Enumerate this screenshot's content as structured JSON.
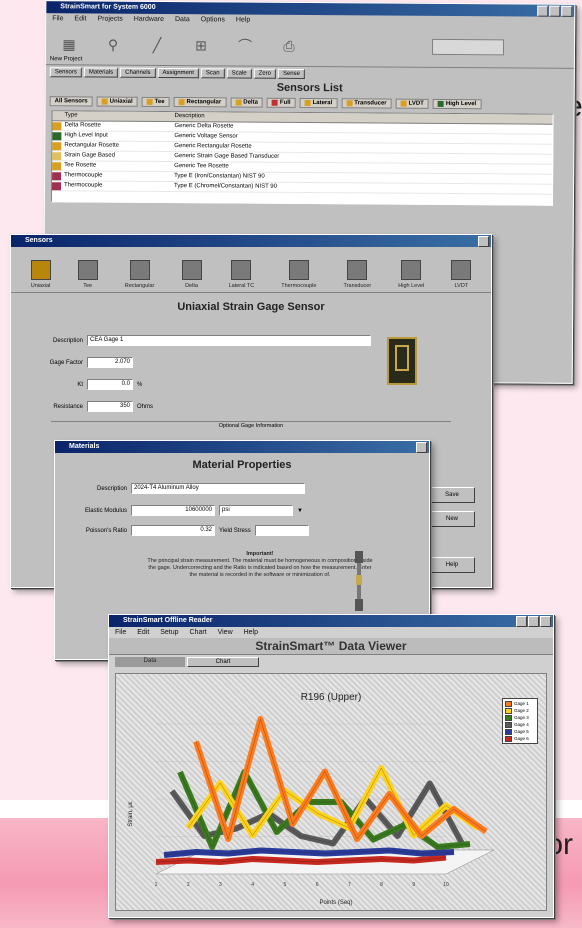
{
  "page": {
    "left_text_1": "e",
    "left_text_2": "for"
  },
  "sensors_window": {
    "title": "StrainSmart for System 6000",
    "menu": [
      "File",
      "Edit",
      "Projects",
      "Hardware",
      "Data",
      "Options",
      "Help"
    ],
    "project_label": "New Project",
    "tabs": [
      "Sensors",
      "Materials",
      "Channels",
      "Assignment",
      "Scan",
      "Scale",
      "Zero",
      "Sense"
    ],
    "heading": "Sensors List",
    "sensor_types": [
      "All Sensors",
      "Uniaxial",
      "Tee",
      "Rectangular",
      "Delta",
      "Full",
      "Lateral",
      "Transducer",
      "LVDT",
      "High Level"
    ],
    "columns": [
      "Type",
      "Description"
    ],
    "rows": [
      {
        "type": "Delta Rosette",
        "desc": "Generic Delta Rosette"
      },
      {
        "type": "High Level Input",
        "desc": "Generic Voltage Sensor"
      },
      {
        "type": "Rectangular Rosette",
        "desc": "Generic Rectangular Rosette"
      },
      {
        "type": "Strain Gage Based",
        "desc": "Generic Strain Gage Based Transducer"
      },
      {
        "type": "Tee Rosette",
        "desc": "Generic Tee Rosette"
      },
      {
        "type": "Thermocouple",
        "desc": "Type E (Iron/Constantan) NIST 90"
      },
      {
        "type": "Thermocouple",
        "desc": "Type E (Chromel/Constantan) NIST 90"
      }
    ]
  },
  "uniaxial_window": {
    "title": "Sensors",
    "toolbar": [
      "Uniaxial",
      "Tee",
      "Rectangular",
      "Delta",
      "Lateral TC",
      "Thermocouple",
      "Transducer",
      "High Level",
      "LVDT"
    ],
    "heading": "Uniaxial Strain Gage Sensor",
    "description_label": "Description",
    "description_value": "CEA Gage 1",
    "gage_factor_label": "Gage Factor",
    "gage_factor_value": "2.070",
    "kt_label": "Kt",
    "kt_value": "0.0",
    "kt_unit": "%",
    "resistance_label": "Resistance",
    "resistance_value": "350",
    "resistance_unit": "Ohms",
    "optional_label": "Optional Gage Information",
    "btn_save": "Save",
    "btn_new": "New",
    "btn_help": "Help"
  },
  "material_window": {
    "title": "Materials",
    "heading": "Material Properties",
    "description_label": "Description",
    "description_value": "2024-T4 Aluminum Alloy",
    "elastic_label": "Elastic Modulus",
    "elastic_value": "10600000",
    "elastic_unit": "psi",
    "poisson_label": "Poisson's Ratio",
    "poisson_value": "0.32",
    "yield_label": "Yield Stress",
    "note_heading": "Important!",
    "note_text": "The principal strain measurement. The material must be homogeneous in composition inside the gage. Undercorrecting and the Ratio is indicated based on how the measurement. Enter the material is recorded in the software or minimization of."
  },
  "viewer_window": {
    "title": "StrainSmart Offline Reader",
    "menu": [
      "File",
      "Edit",
      "Setup",
      "Chart",
      "View",
      "Help"
    ],
    "heading": "StrainSmart™ Data Viewer",
    "tabs": [
      "Data",
      "Chart"
    ],
    "chart_title": "R196 (Upper)",
    "xlabel": "Points (Seq)",
    "ylabel": "Strain, με"
  },
  "chart_data": {
    "type": "line",
    "title": "R196 (Upper)",
    "xlabel": "Points (Seq)",
    "ylabel": "Strain, με",
    "categories": [
      "1",
      "2",
      "3",
      "4",
      "5",
      "6",
      "7",
      "8",
      "9",
      "10"
    ],
    "series": [
      {
        "name": "Gage 1",
        "color": "#ff7a1a",
        "values": [
          75,
          10,
          90,
          20,
          55,
          10,
          40,
          12,
          30,
          15
        ]
      },
      {
        "name": "Gage 2",
        "color": "#ffd21a",
        "values": [
          20,
          50,
          15,
          45,
          30,
          20,
          60,
          15,
          35,
          20
        ]
      },
      {
        "name": "Gage 3",
        "color": "#3a7a1e",
        "values": [
          60,
          10,
          60,
          20,
          40,
          40,
          15,
          25,
          10,
          12
        ]
      },
      {
        "name": "Gage 4",
        "color": "#5a5a5a",
        "values": [
          50,
          20,
          25,
          35,
          20,
          15,
          45,
          20,
          55,
          15
        ]
      },
      {
        "name": "Gage 5",
        "color": "#2a3a9a",
        "values": [
          10,
          12,
          11,
          13,
          12,
          11,
          12,
          13,
          11,
          12
        ]
      },
      {
        "name": "Gage 6",
        "color": "#c8281e",
        "values": [
          8,
          9,
          8,
          10,
          9,
          8,
          9,
          10,
          9,
          11
        ]
      }
    ]
  }
}
